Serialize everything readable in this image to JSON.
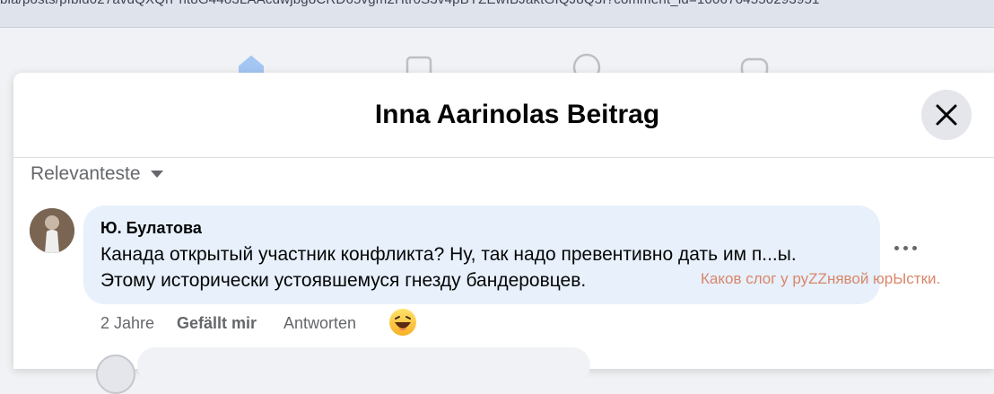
{
  "browser": {
    "url": "bla/posts/pfbid027avdQXQrPht8G44o3LAAcdwjbg8CRD65vgm2Htr0S3v4pBYZEwIBJaktGIQJ8Q3I?comment_id=1006764550293951"
  },
  "topnav": {
    "icons": [
      "home-icon",
      "marketplace-icon",
      "groups-icon",
      "gaming-icon"
    ],
    "accent": "#1877f2"
  },
  "modal": {
    "title": "Inna Aarinolas Beitrag",
    "sort_label": "Relevanteste"
  },
  "comment": {
    "author": "Ю. Булатова",
    "text_line1": "Канада открытый участник конфликта? Ну, так надо превентивно дать им п...ы.",
    "text_line2": "Этому исторически устоявшемуся гнезду бандеровцев.",
    "time": "2 Jahre",
    "like_label": "Gefällt mir",
    "reply_label": "Antworten",
    "reaction": "haha-emoji"
  },
  "watermark": {
    "text": "Каков слог у руZZнявой юрЫстки.",
    "color": "#d9866a"
  }
}
